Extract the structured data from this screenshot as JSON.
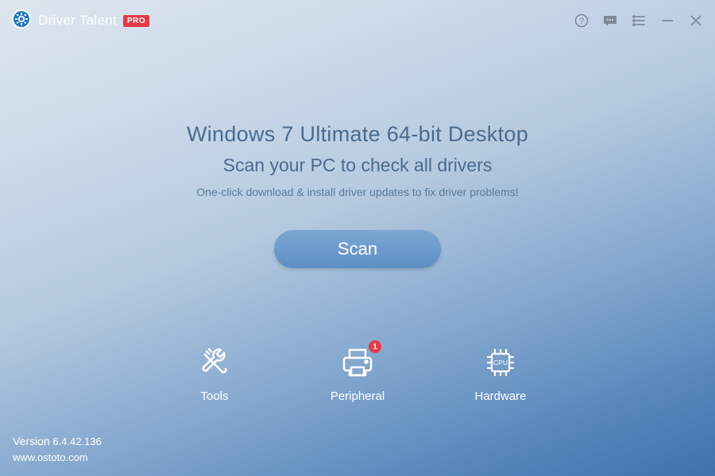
{
  "app": {
    "name": "Driver Talent",
    "pro_badge": "PRO"
  },
  "main": {
    "headline": "Windows 7 Ultimate  64-bit Desktop",
    "subhead": "Scan your PC to check all drivers",
    "description": "One-click download & install driver updates to fix driver problems!",
    "scan_label": "Scan"
  },
  "nav": {
    "tools": {
      "label": "Tools"
    },
    "peripheral": {
      "label": "Peripheral",
      "badge": "1"
    },
    "hardware": {
      "label": "Hardware"
    }
  },
  "footer": {
    "version_word": "Version",
    "version_number": "6.4.42.136",
    "website": "www.ostoto.com"
  }
}
